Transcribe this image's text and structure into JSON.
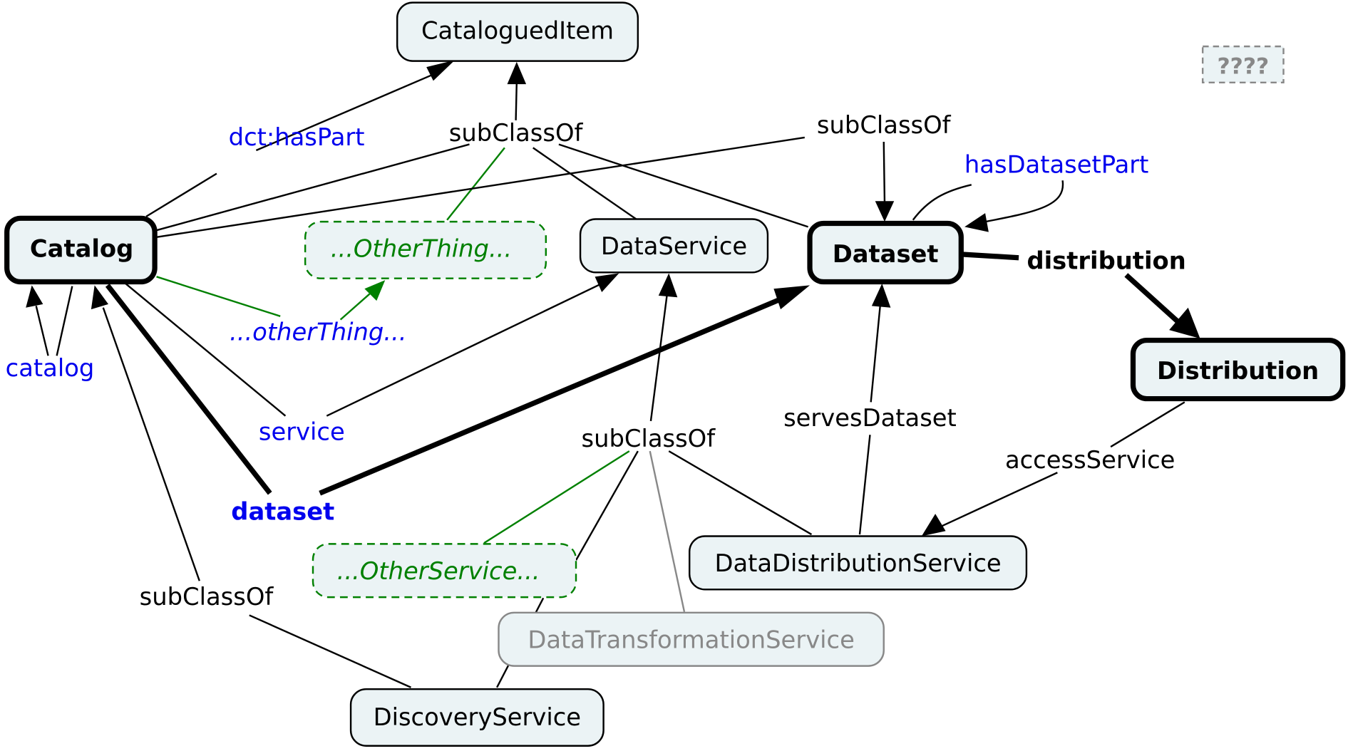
{
  "diagram": {
    "nodes": {
      "catalogued_item": "CataloguedItem",
      "catalog": "Catalog",
      "other_thing": "...OtherThing...",
      "data_service": "DataService",
      "dataset": "Dataset",
      "distribution": "Distribution",
      "other_service": "...OtherService...",
      "data_distribution_service": "DataDistributionService",
      "data_transformation_service": "DataTransformationService",
      "discovery_service": "DiscoveryService",
      "unknown": "????"
    },
    "edge_labels": {
      "dct_has_part": "dct:hasPart",
      "subclass_of_top": "subClassOf",
      "subclass_of_dataset": "subClassOf",
      "has_dataset_part": "hasDatasetPart",
      "distribution": "distribution",
      "catalog": "catalog",
      "other_thing": "...otherThing...",
      "service": "service",
      "dataset": "dataset",
      "subclass_of_services": "subClassOf",
      "serves_dataset": "servesDataset",
      "access_service": "accessService",
      "subclass_of_catalog": "subClassOf"
    },
    "colors": {
      "node_fill": "#ebf3f5",
      "property_blue": "#0000ee",
      "placeholder_green": "#008000",
      "deprecated_gray": "#888888",
      "black": "#000000"
    }
  }
}
